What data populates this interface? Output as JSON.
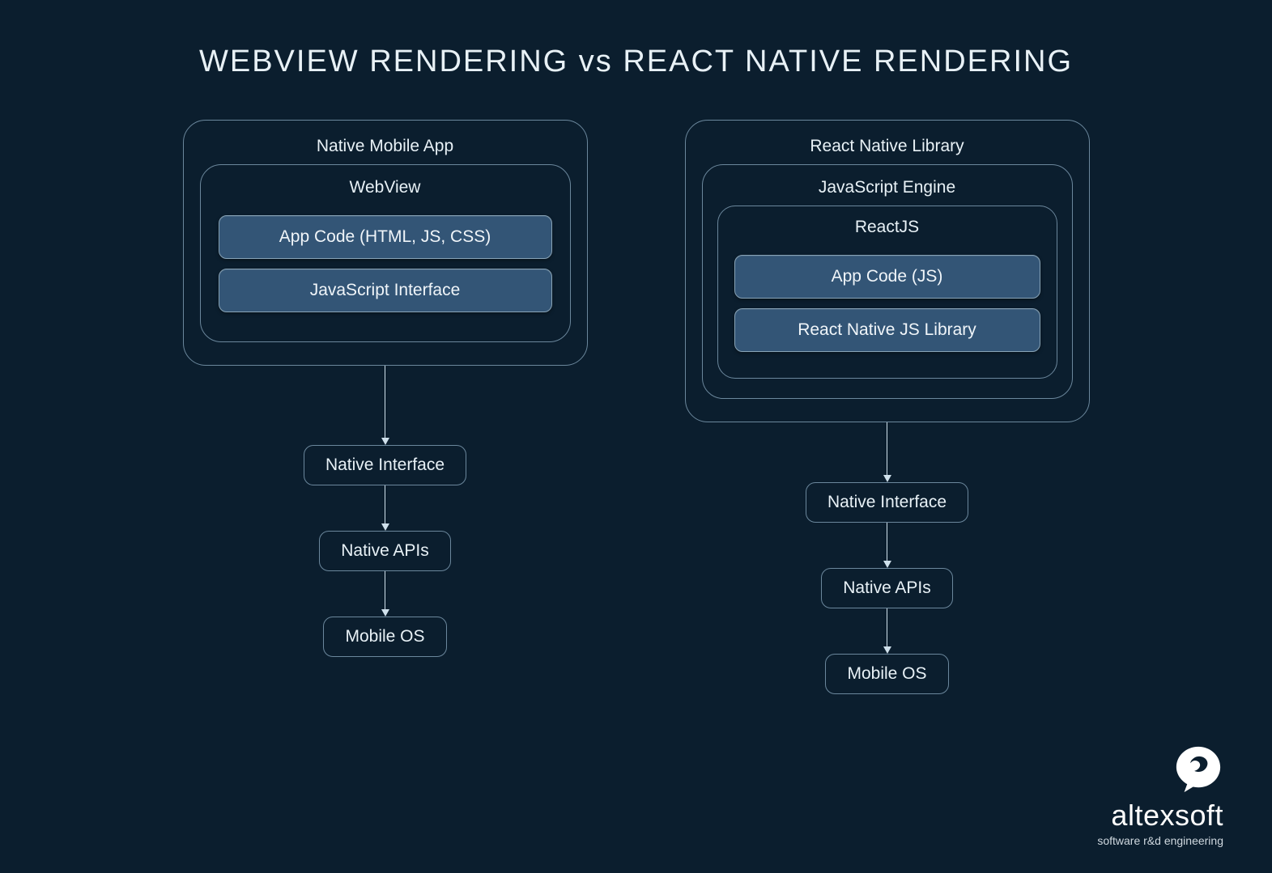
{
  "title": "WEBVIEW RENDERING vs REACT NATIVE RENDERING",
  "left": {
    "outer": "Native Mobile App",
    "mid": "WebView",
    "bar1": "App Code (HTML, JS, CSS)",
    "bar2": "JavaScript Interface",
    "flow1": "Native Interface",
    "flow2": "Native APIs",
    "flow3": "Mobile OS"
  },
  "right": {
    "outer": "React Native Library",
    "mid": "JavaScript Engine",
    "inner": "ReactJS",
    "bar1": "App Code (JS)",
    "bar2": "React Native JS Library",
    "flow1": "Native Interface",
    "flow2": "Native APIs",
    "flow3": "Mobile OS"
  },
  "logo": {
    "name": "altexsoft",
    "tag": "software r&d engineering"
  }
}
